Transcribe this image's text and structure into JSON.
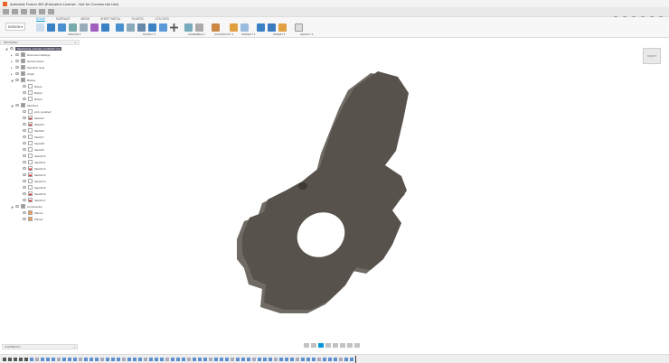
{
  "window": {
    "title": "Autodesk Fusion 360 (Education License - Not for Commercial Use)",
    "document_tab": "Mechanical_Animals_Cuttlefish v10"
  },
  "ribbon": {
    "workspace": "DESIGN ▾",
    "tabs": [
      "SOLID",
      "SURFACE",
      "MESH",
      "SHEET METAL",
      "PLASTIC",
      "UTILITIES"
    ],
    "active_tab": "SOLID",
    "groups": [
      "CREATE ▾",
      "MODIFY ▾",
      "ASSEMBLE ▾",
      "CONSTRUCT ▾",
      "INSPECT ▾",
      "INSERT ▾",
      "SELECT ▾"
    ]
  },
  "browser": {
    "title": "BROWSER",
    "root": "Mechanical_Animals_Cuttlefish v10",
    "top_items": [
      "Document Settings",
      "Named Views",
      "Selection Sets",
      "Origin"
    ],
    "bodies_label": "Bodies",
    "bodies": [
      "Body1",
      "Body2",
      "Body3"
    ],
    "sketches_label": "Sketches",
    "sketches": [
      "joint_sculpted",
      "Sketch2",
      "Sketch3",
      "Sketch6",
      "Sketch7",
      "Sketch8",
      "Sketch9",
      "Sketch10",
      "Sketch11",
      "Sketch12",
      "Sketch13",
      "Sketch14",
      "Sketch15",
      "Sketch16",
      "Sketch17"
    ],
    "construction_label": "Construction",
    "construction": [
      "Plane1",
      "Plane2"
    ]
  },
  "comments": {
    "title": "COMMENTS"
  },
  "viewcube": {
    "label": "FRONT"
  },
  "colors": {
    "accent": "#0696d7",
    "body": "#5a554f",
    "brand": "#e8642a"
  }
}
